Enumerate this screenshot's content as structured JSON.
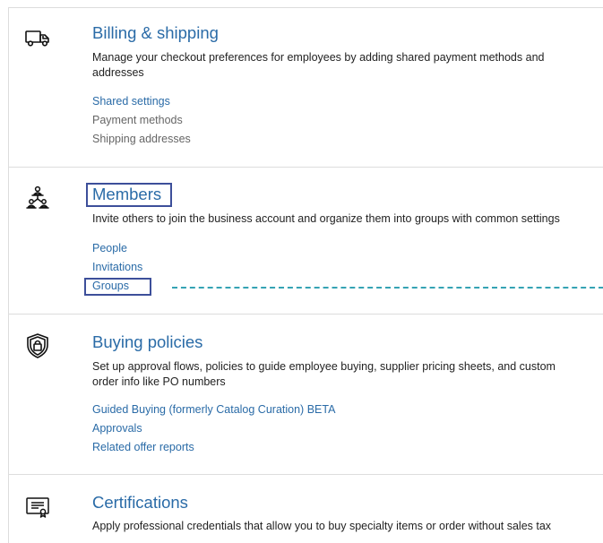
{
  "sections": [
    {
      "title": "Billing & shipping",
      "description": "Manage your checkout preferences for employees by adding shared payment methods and addresses",
      "icon": "delivery-truck-icon",
      "links": [
        "Shared settings",
        "Payment methods",
        "Shipping addresses"
      ]
    },
    {
      "title": "Members",
      "description": "Invite others to join the business account and organize them into groups with common settings",
      "icon": "people-network-icon",
      "links": [
        "People",
        "Invitations",
        "Groups"
      ]
    },
    {
      "title": "Buying policies",
      "description": "Set up approval flows, policies to guide employee buying, supplier pricing sheets, and custom order info like PO numbers",
      "icon": "shield-lock-icon",
      "links": [
        "Guided Buying (formerly Catalog Curation) BETA",
        "Approvals",
        "Related offer reports"
      ]
    },
    {
      "title": "Certifications",
      "description": "Apply professional credentials that allow you to buy specialty items or order without sales tax",
      "icon": "certificate-icon",
      "links": []
    }
  ],
  "colors": {
    "link": "#2a6ba7",
    "muted_link": "#666666",
    "highlight_box": "#3d4f9a",
    "dashed_connector": "#35a3b4"
  }
}
